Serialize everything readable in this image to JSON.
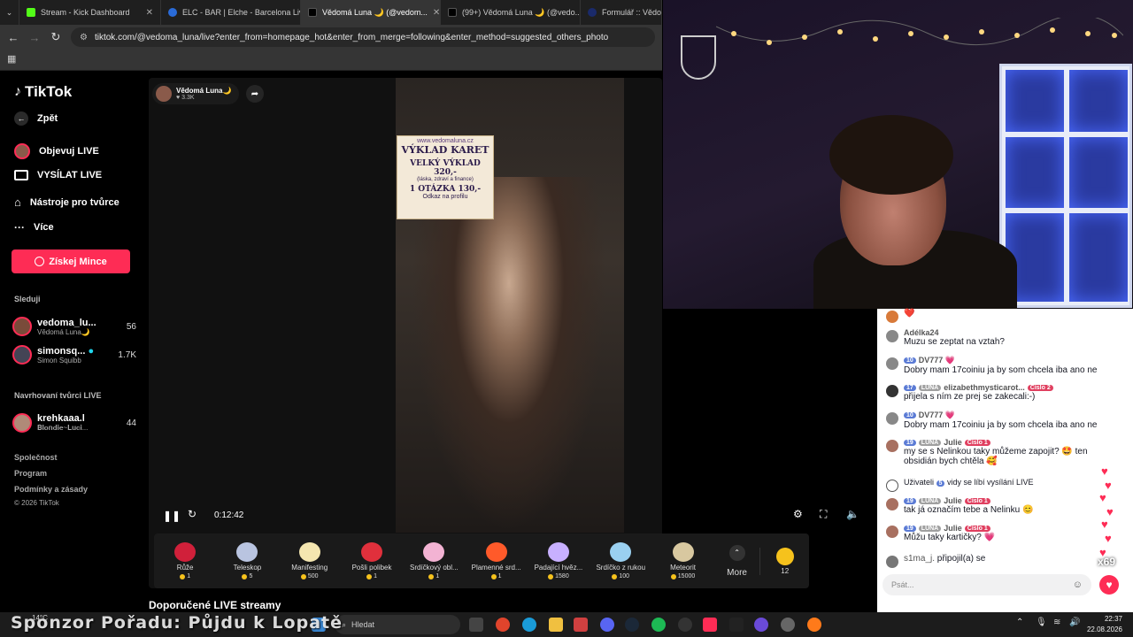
{
  "browser": {
    "tabs": [
      {
        "label": "Stream - Kick Dashboard",
        "color": "#53fc18"
      },
      {
        "label": "ELC - BAR | Elche - Barcelona Liv",
        "color": "#2a6bd8"
      },
      {
        "label": "Vědomá Luna 🌙 (@vedom...",
        "color": "#ffffff"
      },
      {
        "label": "(99+) Vědomá Luna 🌙 (@vedo...",
        "color": "#ffffff"
      },
      {
        "label": "Formulář :: Vědoma",
        "color": "#1a2a6a"
      }
    ],
    "url": "tiktok.com/@vedoma_luna/live?enter_from=homepage_hot&enter_from_merge=following&enter_method=suggested_others_photo"
  },
  "sidebar": {
    "logo": "TikTok",
    "back": "Zpět",
    "nav": [
      "Objevuj LIVE",
      "VYSÍLAT LIVE",
      "Nástroje pro tvůrce",
      "Více"
    ],
    "coins_button": "Získej Mince",
    "following_title": "Sleduji",
    "following": [
      {
        "name": "vedoma_lu...",
        "sub": "Vědomá Luna🌙",
        "count": "56"
      },
      {
        "name": "simonsq...",
        "sub": "Simon Squibb",
        "count": "1.7K"
      }
    ],
    "suggested_title": "Navrhovaní tvůrci LIVE",
    "suggested": [
      {
        "name": "krehkaaa.l",
        "sub": "𝐁𝐥𝐨𝐧𝐝𝐢𝐞~𝐋𝐮𝐜𝐢...",
        "count": "44"
      }
    ],
    "footer": [
      "Společnost",
      "Program",
      "Podmínky a zásady",
      "© 2026 TikTok"
    ]
  },
  "player": {
    "host_name": "Vědomá Luna🌙",
    "host_viewers": "3.3K",
    "time": "0:12:42",
    "promo": {
      "site": "www.vedomaluna.cz",
      "title": "VÝKLAD KARET",
      "big": "VELKÝ VÝKLAD 320,-",
      "topics": "(láska, zdraví a finance)",
      "question": "1 OTÁZKA 130,-",
      "link": "Odkaz na profilu"
    }
  },
  "gifts": [
    {
      "name": "Růže",
      "price": "1",
      "color": "#d0203a"
    },
    {
      "name": "Teleskop",
      "price": "5",
      "color": "#b9c4e0"
    },
    {
      "name": "Manifesting",
      "price": "500",
      "color": "#f4e6b0"
    },
    {
      "name": "Pošli polibek",
      "price": "1",
      "color": "#e0303c"
    },
    {
      "name": "Srdíčkový obl...",
      "price": "1",
      "color": "#f3b3d3"
    },
    {
      "name": "Plamenné srd...",
      "price": "1",
      "color": "#ff5a2a"
    },
    {
      "name": "Padající hvěz...",
      "price": "1580",
      "color": "#c8b0ff"
    },
    {
      "name": "Srdíčko z rukou",
      "price": "100",
      "color": "#9ad0f0"
    },
    {
      "name": "Meteorit",
      "price": "15000",
      "color": "#d8c8a0"
    }
  ],
  "gifts_more": "More",
  "coin_count": "12",
  "recommend_title": "Doporučené LIVE streamy",
  "chat": {
    "messages": [
      {
        "user": "",
        "text": "❤️",
        "badges": []
      },
      {
        "user": "Adélka24",
        "text": "Muzu se zeptat na vztah?",
        "badges": []
      },
      {
        "user": "DV777 💗",
        "text": "Dobry mam 17coiniu ja by som chcela iba ano ne",
        "badges": [
          "10"
        ]
      },
      {
        "user": "elizabethmysticarot...",
        "text": "přijela s ním ze prej se zakecali:-)",
        "badges": [
          "17",
          "LUNA",
          "Číslo 2"
        ]
      },
      {
        "user": "DV777 💗",
        "text": "Dobry mam 17coiniu ja by som chcela iba ano ne",
        "badges": [
          "10"
        ]
      },
      {
        "user": "Julie",
        "text": "my se s Nelinkou taky můžeme zapojit? 🤩 ten obsidián bych chtěla 🥰",
        "badges": [
          "19",
          "LUNA",
          "Číslo 1"
        ]
      },
      {
        "user": "Uživateli",
        "text": "vidy se líbí vysílání LIVE",
        "badges": [
          "5"
        ]
      },
      {
        "user": "Julie",
        "text": "tak já označím tebe a Nelinku 😊",
        "badges": [
          "19",
          "LUNA",
          "Číslo 1"
        ]
      },
      {
        "user": "Julie",
        "text": "Můžu taky kartičky? 💗",
        "badges": [
          "19",
          "LUNA",
          "Číslo 1"
        ]
      },
      {
        "user": "s1ma_j.",
        "text": "připojil(a) se",
        "badges": []
      }
    ],
    "input_placeholder": "Psát...",
    "like_count": "x69"
  },
  "overlay": {
    "sponsor": "Sponzor Pořadu: Půjdu k Lopatě"
  },
  "taskbar": {
    "temp": "14°C",
    "search": "Hledat",
    "time": "22:37",
    "date": "22.08.2026"
  }
}
